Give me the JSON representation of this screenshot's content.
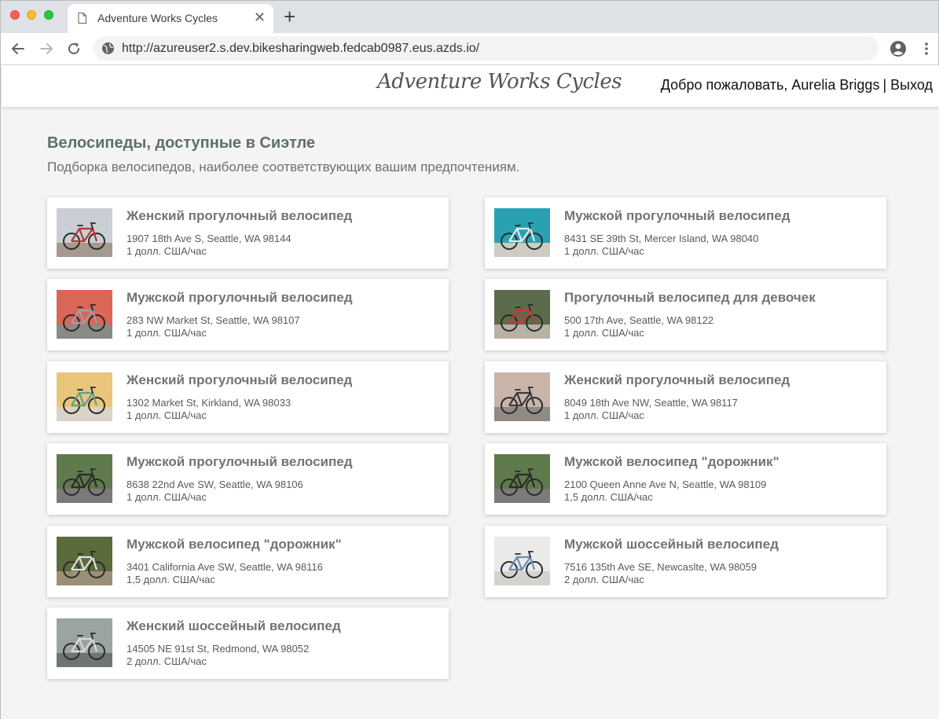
{
  "browser": {
    "tab_title": "Adventure Works Cycles",
    "url": "http://azureuser2.s.dev.bikesharingweb.fedcab0987.eus.azds.io/"
  },
  "header": {
    "logo_text": "Adventure Works Cycles",
    "welcome": "Добро пожаловать, Aurelia Briggs",
    "separator": "|",
    "logout": "Выход"
  },
  "main": {
    "title": "Велосипеды, доступные в Сиэтле",
    "subtitle": "Подборка велосипедов, наиболее соответствующих вашим предпочтениям."
  },
  "bikes": [
    {
      "name": "Женский прогулочный велосипед",
      "address": "1907 18th Ave S, Seattle, WA 98144",
      "price": "1 долл. США/час",
      "bg": "#c9cfd4",
      "ground": "#a49a8e",
      "frame": "#b33636"
    },
    {
      "name": "Мужской прогулочный велосипед",
      "address": "8431 SE 39th St, Mercer Island, WA 98040",
      "price": "1 долл. США/час",
      "bg": "#2aa1b3",
      "ground": "#cfcac2",
      "frame": "#e8ecee"
    },
    {
      "name": "Мужской прогулочный велосипед",
      "address": "283 NW Market St, Seattle, WA 98107",
      "price": "1 долл. США/час",
      "bg": "#d96656",
      "ground": "#8a8a86",
      "frame": "#9aa2a8"
    },
    {
      "name": "Прогулочный велосипед для девочек",
      "address": "500 17th Ave, Seattle, WA 98122",
      "price": "1 долл. США/час",
      "bg": "#5d6b4d",
      "ground": "#b8b1a5",
      "frame": "#c23a3a"
    },
    {
      "name": "Женский прогулочный велосипед",
      "address": "1302 Market St, Kirkland, WA 98033",
      "price": "1 долл. США/час",
      "bg": "#e9c57c",
      "ground": "#d9d3c8",
      "frame": "#5aa38c"
    },
    {
      "name": "Женский прогулочный велосипед",
      "address": "8049 18th Ave NW, Seattle, WA 98117",
      "price": "1 долл. США/час",
      "bg": "#c8b4a8",
      "ground": "#8f8a84",
      "frame": "#3a3a3a"
    },
    {
      "name": "Мужской прогулочный велосипед",
      "address": "8638 22nd Ave SW, Seattle, WA 98106",
      "price": "1 долл. США/час",
      "bg": "#5f7a4c",
      "ground": "#7c7a78",
      "frame": "#2b2b2b"
    },
    {
      "name": "Мужской велосипед \"дорожник\"",
      "address": "2100 Queen Anne Ave N, Seattle, WA 98109",
      "price": "1,5 долл. США/час",
      "bg": "#5f7a4c",
      "ground": "#7c7a78",
      "frame": "#2b2b2b"
    },
    {
      "name": "Мужской велосипед \"дорожник\"",
      "address": "3401 California Ave SW, Seattle, WA 98116",
      "price": "1,5 долл. США/час",
      "bg": "#5b6b3a",
      "ground": "#9c8f78",
      "frame": "#e0e0e0"
    },
    {
      "name": "Мужской шоссейный велосипед",
      "address": "7516 135th Ave SE, Newcaslte, WA 98059",
      "price": "2 долл. США/час",
      "bg": "#eaeaea",
      "ground": "#d4d2cf",
      "frame": "#6f8fb0"
    },
    {
      "name": "Женский шоссейный велосипед",
      "address": "14505 NE 91st St, Redmond, WA 98052",
      "price": "2 долл. США/час",
      "bg": "#9aa5a0",
      "ground": "#6f7572",
      "frame": "#d8d8d8"
    }
  ]
}
